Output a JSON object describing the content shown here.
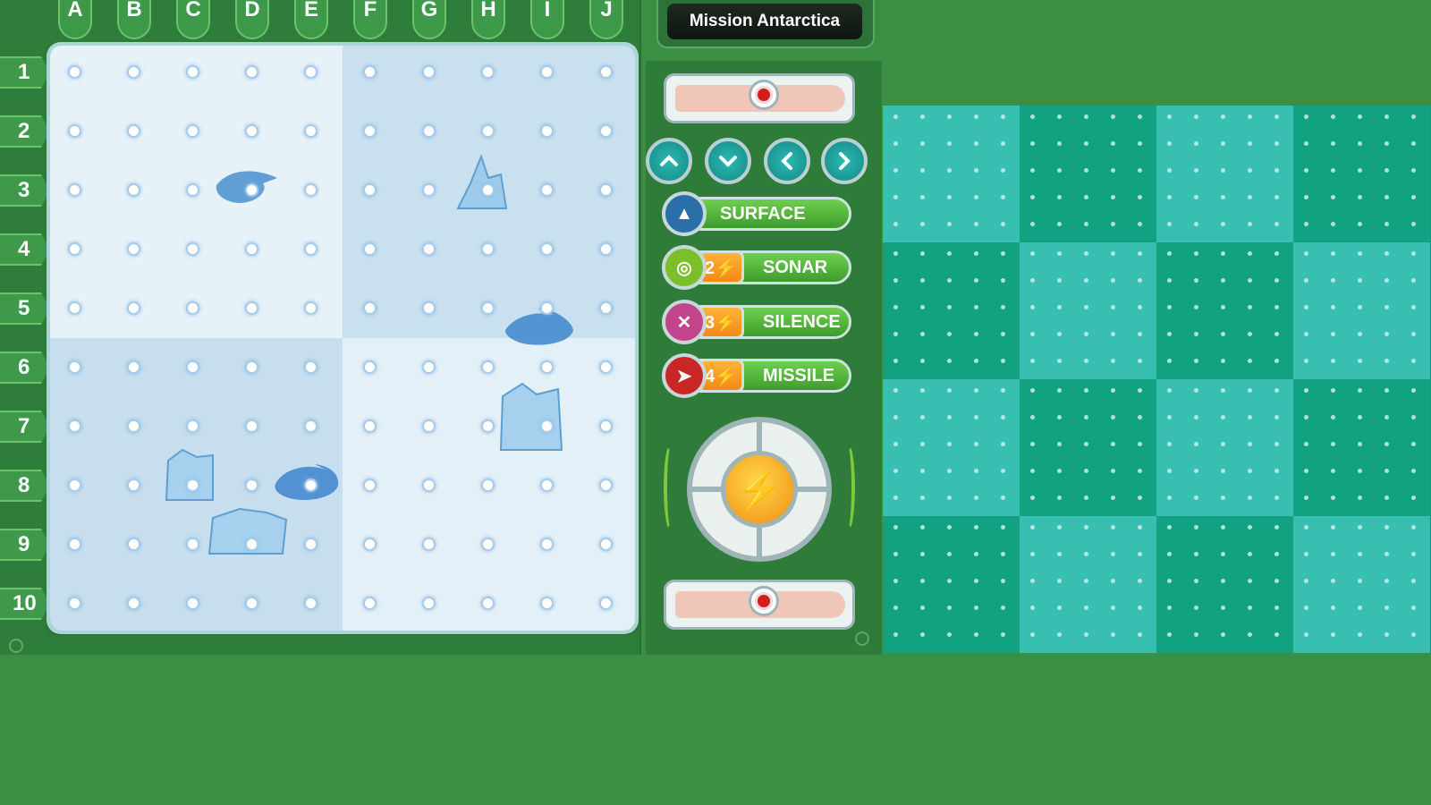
{
  "title": "Mission Antarctica",
  "columns": [
    "A",
    "B",
    "C",
    "D",
    "E",
    "F",
    "G",
    "H",
    "I",
    "J"
  ],
  "rows": [
    "1",
    "2",
    "3",
    "4",
    "5",
    "6",
    "7",
    "8",
    "9",
    "10"
  ],
  "controls": {
    "up_icon": "chevron-up-icon",
    "down_icon": "chevron-down-icon",
    "left_icon": "chevron-left-icon",
    "right_icon": "chevron-right-icon"
  },
  "systems": [
    {
      "id": "surface",
      "label": "SURFACE",
      "cost": "",
      "icon": "surface-icon",
      "color": "#2a6fa8"
    },
    {
      "id": "sonar",
      "label": "SONAR",
      "cost": "2⚡",
      "icon": "sonar-icon",
      "color": "#7bbf2a"
    },
    {
      "id": "silence",
      "label": "SILENCE",
      "cost": "3⚡",
      "icon": "silence-icon",
      "color": "#c2448a"
    },
    {
      "id": "missile",
      "label": "MISSILE",
      "cost": "4⚡",
      "icon": "missile-icon",
      "color": "#c92626"
    }
  ],
  "colors": {
    "ice_light": "#e6f1f8",
    "ice_dark": "#c7e0ee",
    "panel_green": "#2e7b3a",
    "teal_light": "#39bfb2",
    "teal_dark": "#12a282"
  }
}
